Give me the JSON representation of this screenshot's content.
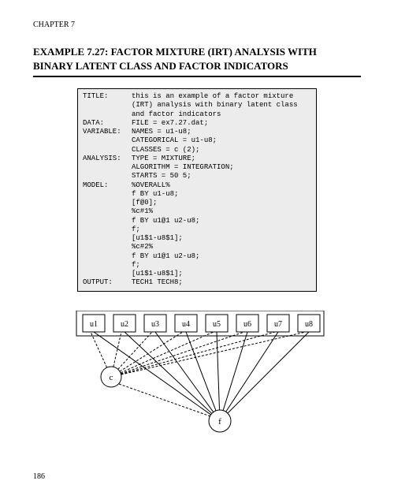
{
  "chapter_label": "CHAPTER 7",
  "title_line1": "EXAMPLE 7.27:  FACTOR MIXTURE (IRT) ANALYSIS WITH",
  "title_line2": "BINARY LATENT CLASS AND FACTOR INDICATORS",
  "code": {
    "lines": [
      {
        "k": "TITLE:",
        "v": "this is an example of a factor mixture"
      },
      {
        "k": "",
        "v": "(IRT) analysis with binary latent class"
      },
      {
        "k": "",
        "v": "and factor indicators"
      },
      {
        "k": "DATA:",
        "v": "FILE = ex7.27.dat;"
      },
      {
        "k": "VARIABLE:",
        "v": "NAMES = u1-u8;"
      },
      {
        "k": "",
        "v": "CATEGORICAL = u1-u8;"
      },
      {
        "k": "",
        "v": "CLASSES = c (2);"
      },
      {
        "k": "ANALYSIS:",
        "v": "TYPE = MIXTURE;"
      },
      {
        "k": "",
        "v": "ALGORITHM = INTEGRATION;"
      },
      {
        "k": "",
        "v": "STARTS = 50 5;"
      },
      {
        "k": "MODEL:",
        "v": "%OVERALL%"
      },
      {
        "k": "",
        "v": "f BY u1-u8;"
      },
      {
        "k": "",
        "v": "[f@0];"
      },
      {
        "k": "",
        "v": "%c#1%"
      },
      {
        "k": "",
        "v": "f BY u1@1 u2-u8;"
      },
      {
        "k": "",
        "v": "f;"
      },
      {
        "k": "",
        "v": "[u1$1-u8$1];"
      },
      {
        "k": "",
        "v": "%c#2%"
      },
      {
        "k": "",
        "v": "f BY u1@1 u2-u8;"
      },
      {
        "k": "",
        "v": "f;"
      },
      {
        "k": "",
        "v": "[u1$1-u8$1];"
      },
      {
        "k": "OUTPUT:",
        "v": "TECH1 TECH8;"
      }
    ]
  },
  "diagram": {
    "indicators": [
      "u1",
      "u2",
      "u3",
      "u4",
      "u5",
      "u6",
      "u7",
      "u8"
    ],
    "latent_class": "c",
    "factor": "f"
  },
  "page_number": "186"
}
